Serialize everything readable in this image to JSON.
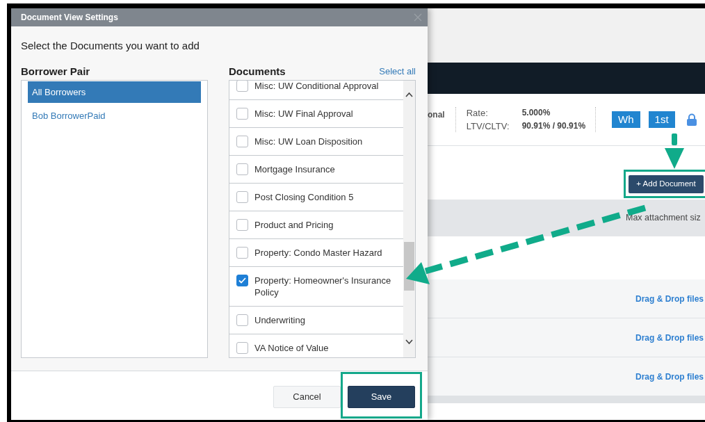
{
  "dialog": {
    "title": "Document View Settings",
    "prompt": "Select the Documents you want to add",
    "borrower_pair": {
      "heading": "Borrower Pair",
      "items": [
        {
          "label": "All Borrowers",
          "selected": true
        },
        {
          "label": "Bob BorrowerPaid",
          "selected": false
        }
      ]
    },
    "documents": {
      "heading": "Documents",
      "select_all": "Select all",
      "items": [
        {
          "label": "Misc: UW Conditional Approval",
          "checked": false
        },
        {
          "label": "Misc: UW Final Approval",
          "checked": false
        },
        {
          "label": "Misc: UW Loan Disposition",
          "checked": false
        },
        {
          "label": "Mortgage Insurance",
          "checked": false
        },
        {
          "label": "Post Closing Condition 5",
          "checked": false
        },
        {
          "label": "Product and Pricing",
          "checked": false
        },
        {
          "label": "Property: Condo Master Hazard",
          "checked": false
        },
        {
          "label": "Property: Homeowner's Insurance Policy",
          "checked": true
        },
        {
          "label": "Underwriting",
          "checked": false
        },
        {
          "label": "VA Notice of Value",
          "checked": false
        }
      ]
    },
    "buttons": [
      {
        "label": "Cancel",
        "kind": "secondary",
        "highlighted": false
      },
      {
        "label": "Save",
        "kind": "primary",
        "highlighted": true
      }
    ]
  },
  "background": {
    "loan_type_fragment": "onal",
    "rate_label": "Rate:",
    "rate": "5.000%",
    "ltv_label": "LTV/CLTV:",
    "ltv": "90.91% / 90.91%",
    "toggles": [
      "Wh",
      "1st"
    ],
    "add_document": {
      "label": "+ Add Document",
      "highlighted": true
    },
    "attachment_note": "Max attachment siz",
    "rows": [
      {
        "drop_link": "Drag & Drop files"
      },
      {
        "drop_link": "Drag & Drop files"
      },
      {
        "drop_link": "Drag & Drop files"
      }
    ]
  }
}
